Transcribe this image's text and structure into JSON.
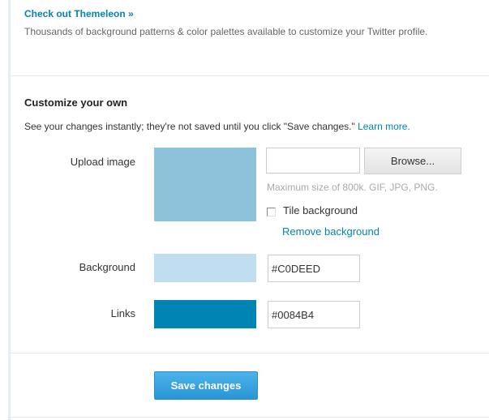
{
  "promo": {
    "link_label": "Check out Themeleon »",
    "description": "Thousands of background patterns & color palettes available to customize your Twitter profile."
  },
  "customize": {
    "title": "Customize your own",
    "instructions": "See your changes instantly; they're not saved until you click \"Save changes.\"",
    "learn_more_label": "Learn more."
  },
  "upload": {
    "label": "Upload image",
    "file_value": "",
    "browse_label": "Browse...",
    "hint": "Maximum size of 800k. GIF, JPG, PNG.",
    "tile_label": "Tile background",
    "tile_checked": false,
    "remove_label": "Remove background",
    "preview_color": "#8EC1DA"
  },
  "background": {
    "label": "Background",
    "value": "#C0DEED",
    "swatch_color": "#C0DEED"
  },
  "links": {
    "label": "Links",
    "value": "#0084B4",
    "swatch_color": "#0084B4"
  },
  "actions": {
    "save_label": "Save changes"
  },
  "colors": {
    "accent": "#0084B4",
    "button_gradient_top": "#4CB3EA",
    "button_gradient_bottom": "#2A94D4",
    "rail": "#E4EEF6"
  }
}
